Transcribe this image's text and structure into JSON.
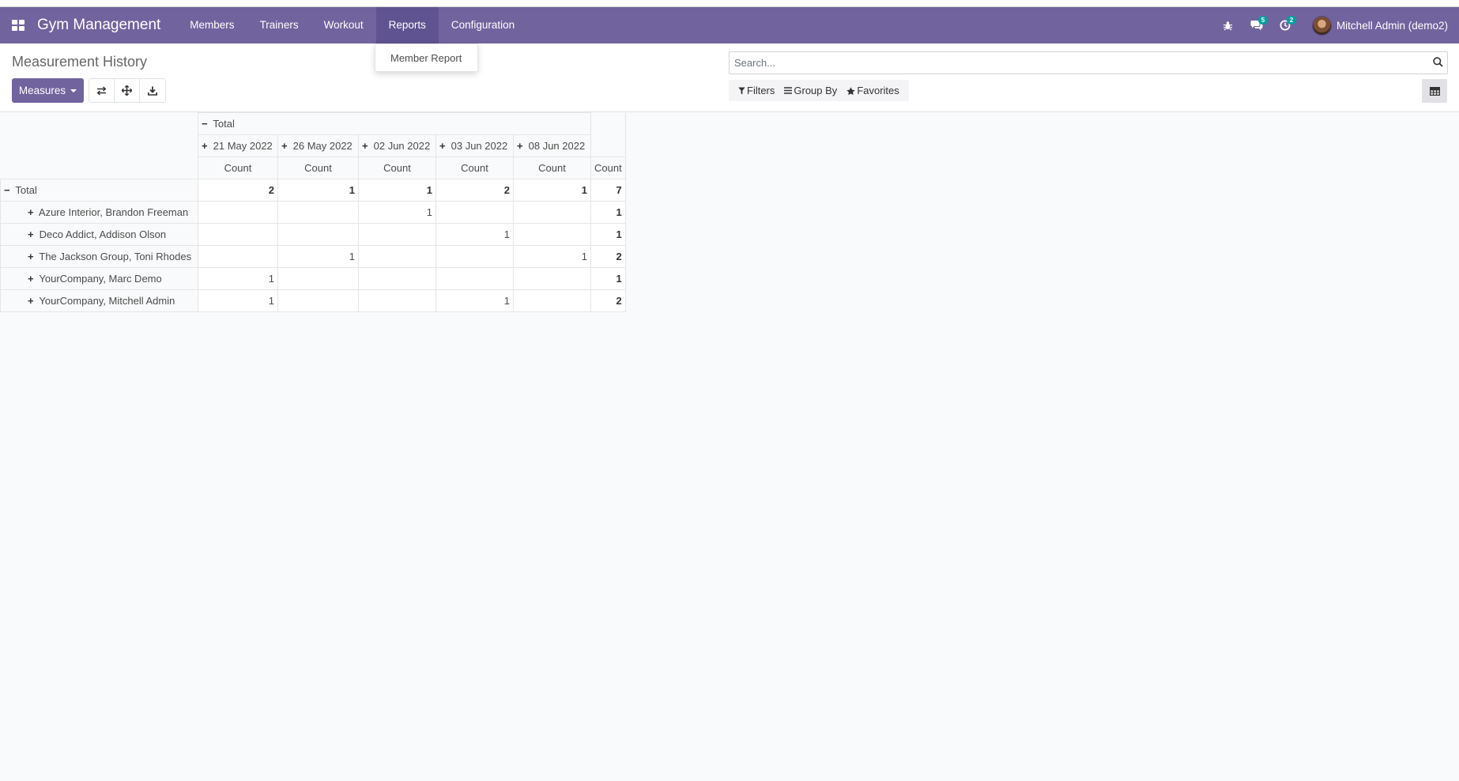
{
  "navbar": {
    "brand": "Gym Management",
    "menu": [
      {
        "label": "Members"
      },
      {
        "label": "Trainers"
      },
      {
        "label": "Workout"
      },
      {
        "label": "Reports"
      },
      {
        "label": "Configuration"
      }
    ],
    "messages_badge": "5",
    "activities_badge": "2",
    "user": "Mitchell Admin (demo2)",
    "accent": "#71639e",
    "active_menu": "Reports"
  },
  "dropdown": {
    "items": [
      {
        "label": "Member Report"
      }
    ]
  },
  "control": {
    "title": "Measurement History",
    "measures_label": "Measures",
    "search_placeholder": "Search...",
    "filters_label": "Filters",
    "groupby_label": "Group By",
    "favorites_label": "Favorites",
    "icons": [
      "flip-axis-icon",
      "expand-all-icon",
      "download-icon",
      "pivot-view-icon"
    ]
  },
  "pivot": {
    "col_total": "Total",
    "columns": [
      "21 May 2022",
      "26 May 2022",
      "02 Jun 2022",
      "03 Jun 2022",
      "08 Jun 2022"
    ],
    "measure": "Count",
    "row_total_label": "Total",
    "totals": [
      "2",
      "1",
      "1",
      "2",
      "1",
      "7"
    ],
    "rows": [
      {
        "label": "Azure Interior, Brandon Freeman",
        "cells": [
          "",
          "",
          "1",
          "",
          ""
        ],
        "total": "1"
      },
      {
        "label": "Deco Addict, Addison Olson",
        "cells": [
          "",
          "",
          "",
          "1",
          ""
        ],
        "total": "1"
      },
      {
        "label": "The Jackson Group, Toni Rhodes",
        "cells": [
          "",
          "1",
          "",
          "",
          "1"
        ],
        "total": "2"
      },
      {
        "label": "YourCompany, Marc Demo",
        "cells": [
          "1",
          "",
          "",
          "",
          ""
        ],
        "total": "1"
      },
      {
        "label": "YourCompany, Mitchell Admin",
        "cells": [
          "1",
          "",
          "",
          "1",
          ""
        ],
        "total": "2"
      }
    ]
  }
}
